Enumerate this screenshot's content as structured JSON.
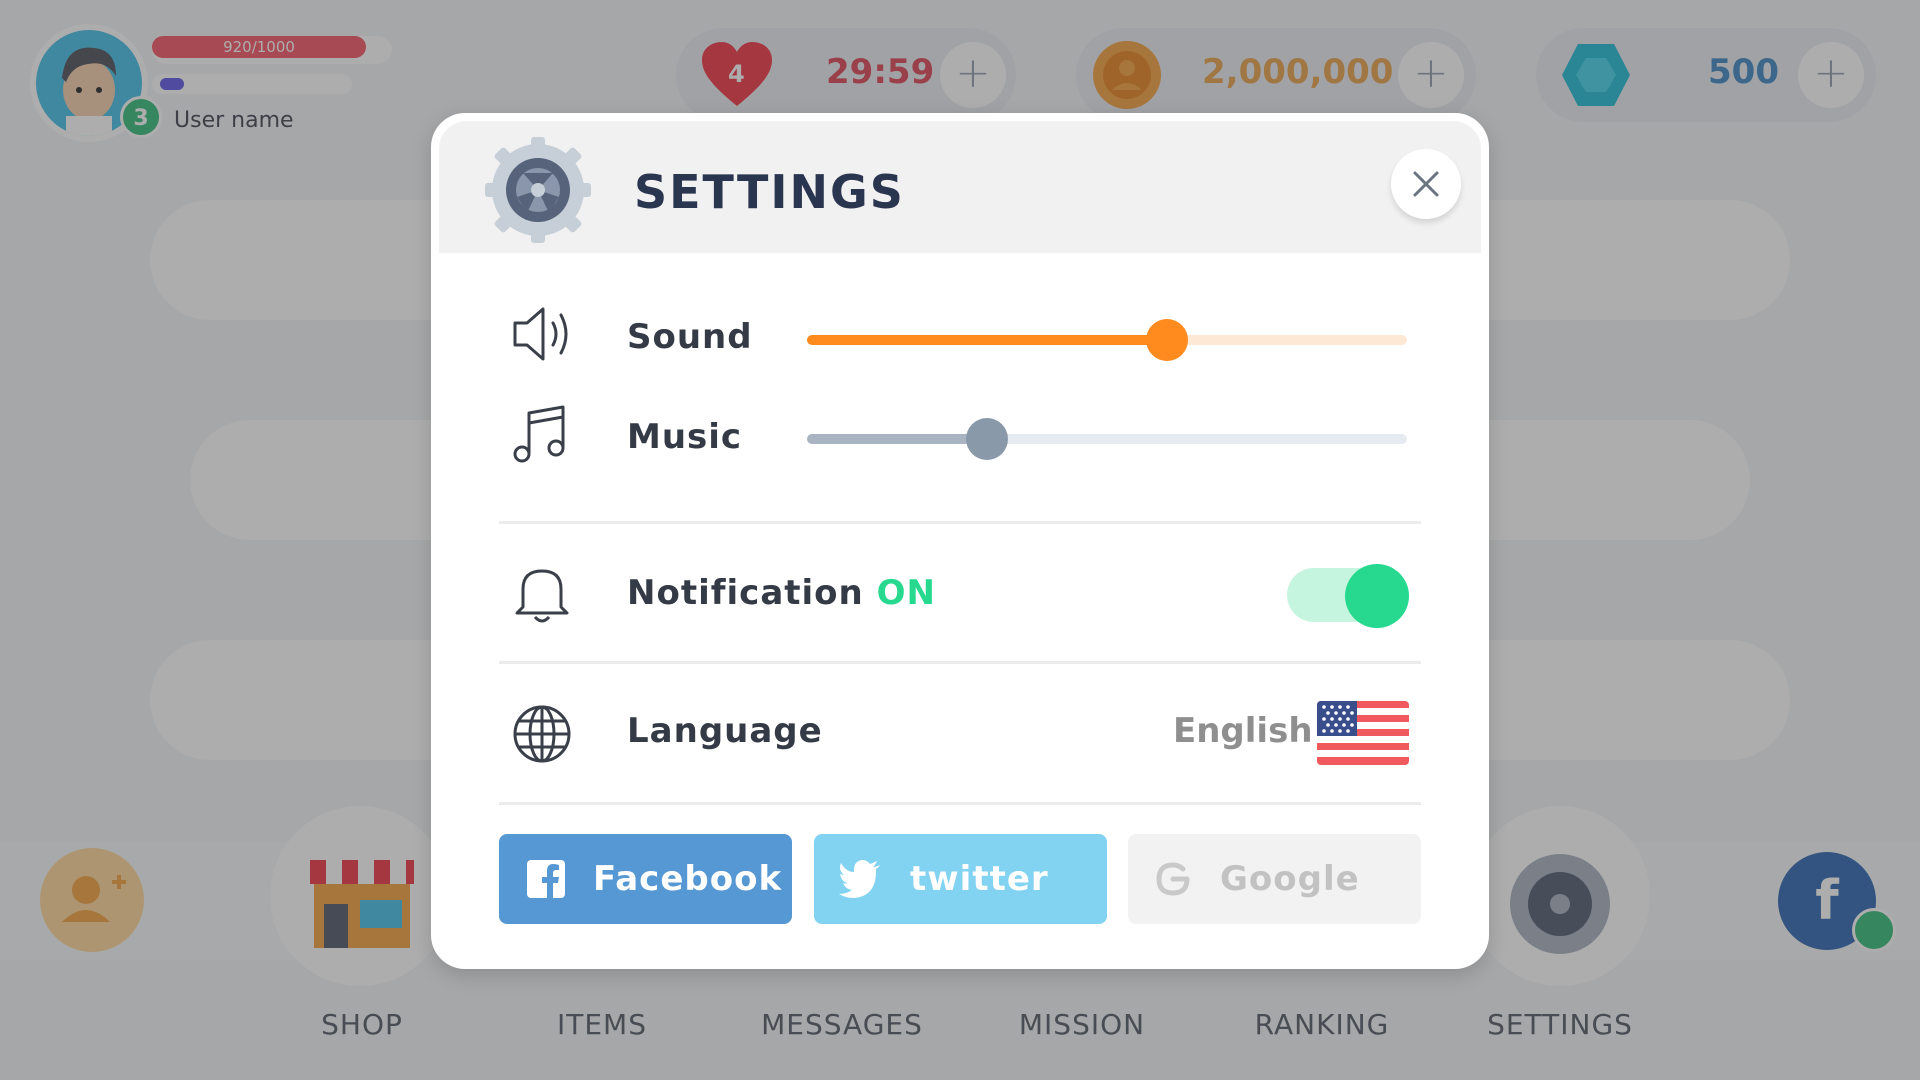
{
  "hud": {
    "player_level": "3",
    "xp_text": "920/1000",
    "username": "User name",
    "lives": "4",
    "life_timer": "29:59",
    "coins": "2,000,000",
    "gems": "500",
    "plus": "+"
  },
  "nav": {
    "items": [
      {
        "label": "SHOP"
      },
      {
        "label": "ITEMS"
      },
      {
        "label": "MESSAGES"
      },
      {
        "label": "MISSION"
      },
      {
        "label": "RANKING"
      },
      {
        "label": "SETTINGS"
      }
    ]
  },
  "settings": {
    "title": "SETTINGS",
    "sound": {
      "label": "Sound",
      "value_fraction": 0.6
    },
    "music": {
      "label": "Music",
      "value_fraction": 0.3
    },
    "notification": {
      "label": "Notification",
      "state": "ON",
      "enabled": true
    },
    "language": {
      "label": "Language",
      "value": "English",
      "flag": "us-flag-icon"
    },
    "social": {
      "facebook": "Facebook",
      "twitter": "twitter",
      "google": "Google"
    }
  },
  "colors": {
    "accent_orange": "#ff8a1e",
    "accent_green": "#27d98f",
    "title_navy": "#2a3550",
    "facebook_blue": "#5698d3",
    "twitter_blue": "#82d2f2",
    "google_disabled": "#f2f2f2",
    "music_slider": "#8a99aa"
  }
}
